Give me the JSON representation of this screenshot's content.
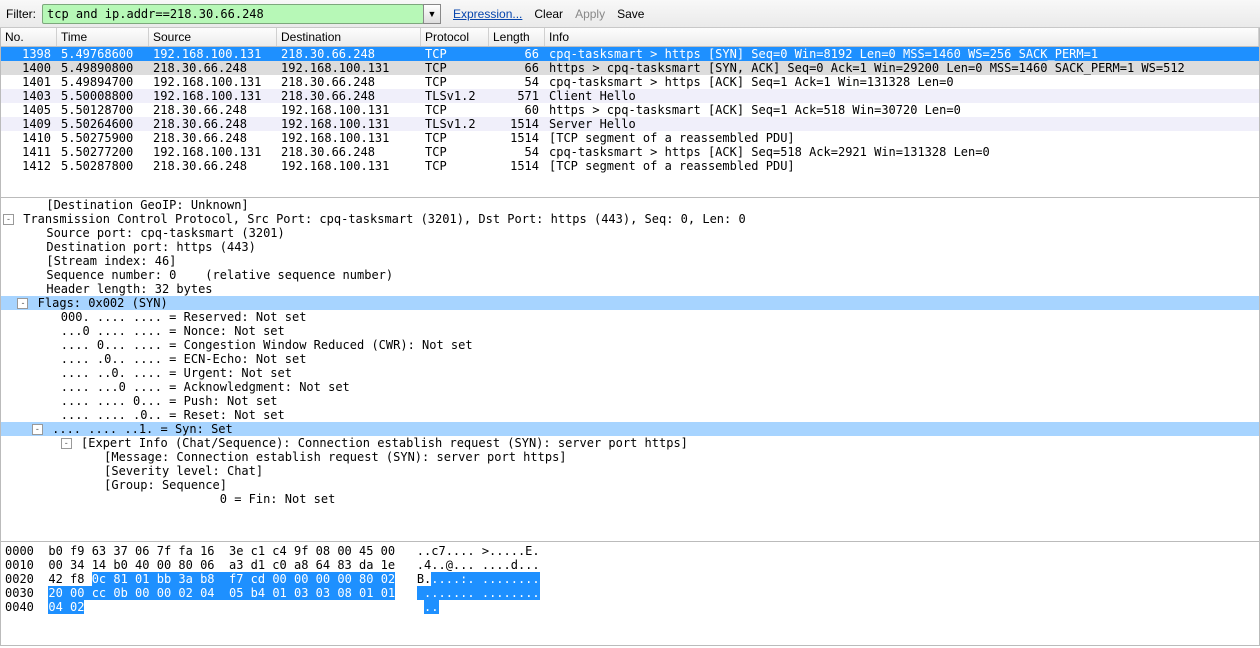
{
  "toolbar": {
    "filter_label": "Filter:",
    "filter_value": "tcp and ip.addr==218.30.66.248",
    "expression_label": "Expression...",
    "clear_label": "Clear",
    "apply_label": "Apply",
    "save_label": "Save"
  },
  "columns": {
    "no": "No.",
    "time": "Time",
    "source": "Source",
    "destination": "Destination",
    "protocol": "Protocol",
    "length": "Length",
    "info": "Info"
  },
  "packets": [
    {
      "no": "1398",
      "time": "5.49768600",
      "src": "192.168.100.131",
      "dst": "218.30.66.248",
      "proto": "TCP",
      "len": "66",
      "info": "cpq-tasksmart > https [SYN] Seq=0 Win=8192 Len=0 MSS=1460 WS=256 SACK_PERM=1",
      "cls": "sel"
    },
    {
      "no": "1400",
      "time": "5.49890800",
      "src": "218.30.66.248",
      "dst": "192.168.100.131",
      "proto": "TCP",
      "len": "66",
      "info": "https > cpq-tasksmart [SYN, ACK] Seq=0 Ack=1 Win=29200 Len=0 MSS=1460 SACK_PERM=1 WS=512",
      "cls": "shade"
    },
    {
      "no": "1401",
      "time": "5.49894700",
      "src": "192.168.100.131",
      "dst": "218.30.66.248",
      "proto": "TCP",
      "len": "54",
      "info": "cpq-tasksmart > https [ACK] Seq=1 Ack=1 Win=131328 Len=0",
      "cls": ""
    },
    {
      "no": "1403",
      "time": "5.50008800",
      "src": "192.168.100.131",
      "dst": "218.30.66.248",
      "proto": "TLSv1.2",
      "len": "571",
      "info": "Client Hello",
      "cls": "lav"
    },
    {
      "no": "1405",
      "time": "5.50128700",
      "src": "218.30.66.248",
      "dst": "192.168.100.131",
      "proto": "TCP",
      "len": "60",
      "info": "https > cpq-tasksmart [ACK] Seq=1 Ack=518 Win=30720 Len=0",
      "cls": ""
    },
    {
      "no": "1409",
      "time": "5.50264600",
      "src": "218.30.66.248",
      "dst": "192.168.100.131",
      "proto": "TLSv1.2",
      "len": "1514",
      "info": "Server Hello",
      "cls": "lav"
    },
    {
      "no": "1410",
      "time": "5.50275900",
      "src": "218.30.66.248",
      "dst": "192.168.100.131",
      "proto": "TCP",
      "len": "1514",
      "info": "[TCP segment of a reassembled PDU]",
      "cls": ""
    },
    {
      "no": "1411",
      "time": "5.50277200",
      "src": "192.168.100.131",
      "dst": "218.30.66.248",
      "proto": "TCP",
      "len": "54",
      "info": "cpq-tasksmart > https [ACK] Seq=518 Ack=2921 Win=131328 Len=0",
      "cls": ""
    },
    {
      "no": "1412",
      "time": "5.50287800",
      "src": "218.30.66.248",
      "dst": "192.168.100.131",
      "proto": "TCP",
      "len": "1514",
      "info": "[TCP segment of a reassembled PDU]",
      "cls": ""
    }
  ],
  "details": [
    {
      "ind": 3,
      "tw": "",
      "text": "[Destination GeoIP: Unknown]",
      "hl": false
    },
    {
      "ind": 1,
      "tw": "-",
      "text": "Transmission Control Protocol, Src Port: cpq-tasksmart (3201), Dst Port: https (443), Seq: 0, Len: 0",
      "hl": false
    },
    {
      "ind": 3,
      "tw": "",
      "text": "Source port: cpq-tasksmart (3201)",
      "hl": false
    },
    {
      "ind": 3,
      "tw": "",
      "text": "Destination port: https (443)",
      "hl": false
    },
    {
      "ind": 3,
      "tw": "",
      "text": "[Stream index: 46]",
      "hl": false
    },
    {
      "ind": 3,
      "tw": "",
      "text": "Sequence number: 0    (relative sequence number)",
      "hl": false
    },
    {
      "ind": 3,
      "tw": "",
      "text": "Header length: 32 bytes",
      "hl": false
    },
    {
      "ind": 2,
      "tw": "-",
      "text": "Flags: 0x002 (SYN)",
      "hl": true
    },
    {
      "ind": 4,
      "tw": "",
      "text": "000. .... .... = Reserved: Not set",
      "hl": false
    },
    {
      "ind": 4,
      "tw": "",
      "text": "...0 .... .... = Nonce: Not set",
      "hl": false
    },
    {
      "ind": 4,
      "tw": "",
      "text": ".... 0... .... = Congestion Window Reduced (CWR): Not set",
      "hl": false
    },
    {
      "ind": 4,
      "tw": "",
      "text": ".... .0.. .... = ECN-Echo: Not set",
      "hl": false
    },
    {
      "ind": 4,
      "tw": "",
      "text": ".... ..0. .... = Urgent: Not set",
      "hl": false
    },
    {
      "ind": 4,
      "tw": "",
      "text": ".... ...0 .... = Acknowledgment: Not set",
      "hl": false
    },
    {
      "ind": 4,
      "tw": "",
      "text": ".... .... 0... = Push: Not set",
      "hl": false
    },
    {
      "ind": 4,
      "tw": "",
      "text": ".... .... .0.. = Reset: Not set",
      "hl": false
    },
    {
      "ind": 3,
      "tw": "-",
      "text": ".... .... ..1. = Syn: Set",
      "hl": true
    },
    {
      "ind": 5,
      "tw": "-",
      "text": "[Expert Info (Chat/Sequence): Connection establish request (SYN): server port https]",
      "hl": false
    },
    {
      "ind": 7,
      "tw": "",
      "text": "[Message: Connection establish request (SYN): server port https]",
      "hl": false
    },
    {
      "ind": 7,
      "tw": "",
      "text": "[Severity level: Chat]",
      "hl": false
    },
    {
      "ind": 7,
      "tw": "",
      "text": "[Group: Sequence]",
      "hl": false
    },
    {
      "ind": 15,
      "tw": "",
      "text": "0 = Fin: Not set",
      "hl": false
    }
  ],
  "hex": [
    {
      "off": "0000",
      "b1": "b0 f9 63 37 06 7f fa 16",
      "b2": "3e c1 c4 9f 08 00 45 00",
      "a": "..c7.... >.....E.",
      "sel": 0
    },
    {
      "off": "0010",
      "b1": "00 34 14 b0 40 00 80 06",
      "b2": "a3 d1 c0 a8 64 83 da 1e",
      "a": ".4..@... ....d...",
      "sel": 0
    },
    {
      "off": "0020",
      "b1": "42 f8",
      "b1s": "0c 81 01 bb 3a b8",
      "b2": "f7 cd 00 00 00 00 80 02",
      "a": "B.",
      "as": "....:. ........",
      "sel": 1
    },
    {
      "off": "0030",
      "b1": "",
      "b1s": "20 00 cc 0b 00 00 02 04",
      "b2": "05 b4 01 03 03 08 01 01",
      "a": "",
      "as": " ....... ........",
      "sel": 2
    },
    {
      "off": "0040",
      "b1": "",
      "b1s": "04 02",
      "b2": "",
      "a": "",
      "as": "..",
      "sel": 3
    }
  ]
}
